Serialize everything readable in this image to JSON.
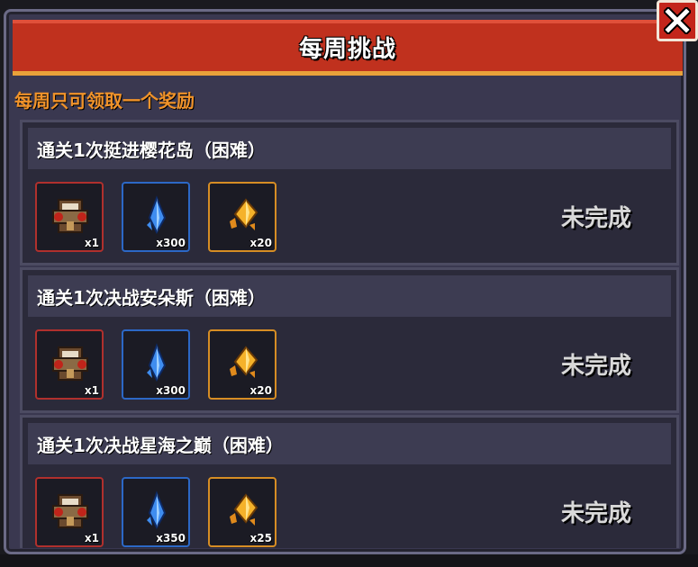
{
  "dialog": {
    "title": "每周挑战",
    "close_icon": "close-icon",
    "notice": "每周只可领取一个奖励"
  },
  "challenges": [
    {
      "title": "通关1次挺进樱花岛（困难）",
      "status": "未完成",
      "rewards": [
        {
          "icon": "material-chest-icon",
          "qty": "x1",
          "color": "#b0302d"
        },
        {
          "icon": "blue-gem-icon",
          "qty": "x300",
          "color": "#2c68c6"
        },
        {
          "icon": "gold-crystal-icon",
          "qty": "x20",
          "color": "#d68d24"
        }
      ]
    },
    {
      "title": "通关1次决战安朵斯（困难）",
      "status": "未完成",
      "rewards": [
        {
          "icon": "material-chest-icon",
          "qty": "x1",
          "color": "#b0302d"
        },
        {
          "icon": "blue-gem-icon",
          "qty": "x300",
          "color": "#2c68c6"
        },
        {
          "icon": "gold-crystal-icon",
          "qty": "x20",
          "color": "#d68d24"
        }
      ]
    },
    {
      "title": "通关1次决战星海之巅（困难）",
      "status": "未完成",
      "rewards": [
        {
          "icon": "material-chest-icon",
          "qty": "x1",
          "color": "#b0302d"
        },
        {
          "icon": "blue-gem-icon",
          "qty": "x350",
          "color": "#2c68c6"
        },
        {
          "icon": "gold-crystal-icon",
          "qty": "x25",
          "color": "#d68d24"
        }
      ]
    }
  ]
}
